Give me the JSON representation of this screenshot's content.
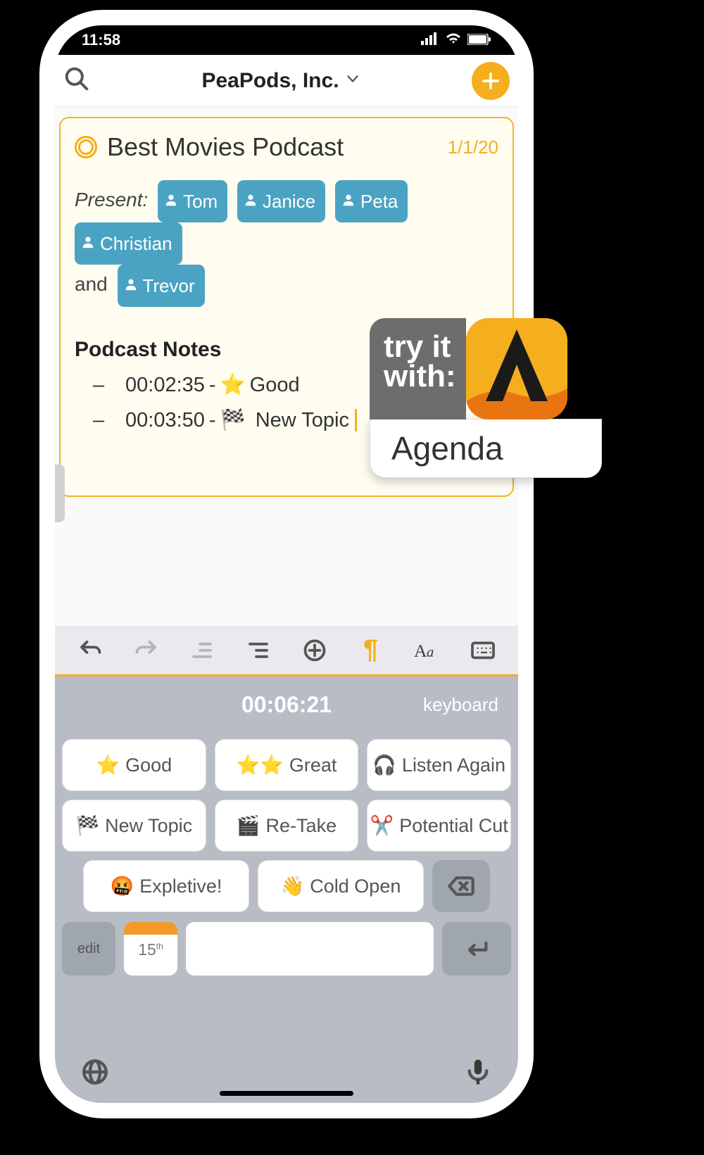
{
  "status": {
    "time": "11:58"
  },
  "nav": {
    "title": "PeaPods, Inc."
  },
  "note": {
    "title": "Best Movies Podcast",
    "date": "1/1/20",
    "present_label": "Present:",
    "and_label": "and",
    "people": [
      "Tom",
      "Janice",
      "Peta",
      "Christian",
      "Trevor"
    ],
    "section_title": "Podcast Notes",
    "items": [
      {
        "time": "00:02:35",
        "emoji": "⭐",
        "text": "Good"
      },
      {
        "time": "00:03:50",
        "emoji": "🏁",
        "text": "New Topic"
      }
    ]
  },
  "keyboard": {
    "timer": "00:06:21",
    "mode_label": "keyboard",
    "tags": [
      {
        "emoji": "⭐",
        "label": "Good"
      },
      {
        "emoji": "⭐⭐",
        "label": "Great"
      },
      {
        "emoji": "🎧",
        "label": "Listen Again"
      },
      {
        "emoji": "🏁",
        "label": "New Topic"
      },
      {
        "emoji": "🎬",
        "label": "Re-Take"
      },
      {
        "emoji": "✂️",
        "label": "Potential Cut"
      },
      {
        "emoji": "🤬",
        "label": "Expletive!"
      },
      {
        "emoji": "👋",
        "label": "Cold Open"
      }
    ],
    "edit_label": "edit",
    "date_day": "15",
    "date_suffix": "th"
  },
  "promo": {
    "line1": "try it",
    "line2": "with:",
    "app_name": "Agenda"
  }
}
